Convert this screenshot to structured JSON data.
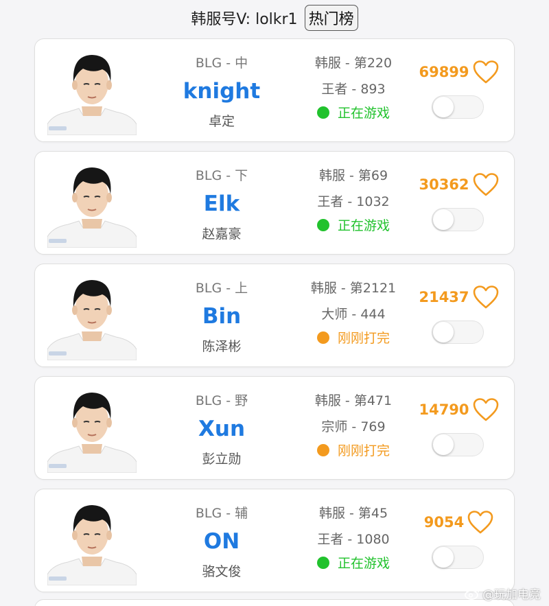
{
  "header": {
    "title": "韩服号V: lolkr1",
    "hot_button": "热门榜"
  },
  "colors": {
    "nickname": "#1f7ae0",
    "score": "#f39a1e",
    "playing": "#21c22d",
    "recent": "#f39a1e"
  },
  "players": [
    {
      "team_pos": "BLG - 中",
      "nickname": "knight",
      "real_name": "卓定",
      "server_rank": "韩服 - 第220",
      "tier": "王者 - 893",
      "status": "正在游戏",
      "status_color": "#21c22d",
      "score": "69899",
      "favorite_icon": "heart-outline-icon",
      "notify_on": false,
      "avatar_icon": "player-photo"
    },
    {
      "team_pos": "BLG - 下",
      "nickname": "Elk",
      "real_name": "赵嘉豪",
      "server_rank": "韩服 - 第69",
      "tier": "王者 - 1032",
      "status": "正在游戏",
      "status_color": "#21c22d",
      "score": "30362",
      "favorite_icon": "heart-outline-icon",
      "notify_on": false,
      "avatar_icon": "player-photo"
    },
    {
      "team_pos": "BLG - 上",
      "nickname": "Bin",
      "real_name": "陈泽彬",
      "server_rank": "韩服 - 第2121",
      "tier": "大师 - 444",
      "status": "刚刚打完",
      "status_color": "#f39a1e",
      "score": "21437",
      "favorite_icon": "heart-outline-icon",
      "notify_on": false,
      "avatar_icon": "player-photo"
    },
    {
      "team_pos": "BLG - 野",
      "nickname": "Xun",
      "real_name": "彭立勋",
      "server_rank": "韩服 - 第471",
      "tier": "宗师 - 769",
      "status": "刚刚打完",
      "status_color": "#f39a1e",
      "score": "14790",
      "favorite_icon": "heart-outline-icon",
      "notify_on": false,
      "avatar_icon": "player-photo"
    },
    {
      "team_pos": "BLG - 辅",
      "nickname": "ON",
      "real_name": "骆文俊",
      "server_rank": "韩服 - 第45",
      "tier": "王者 - 1080",
      "status": "正在游戏",
      "status_color": "#21c22d",
      "score": "9054",
      "favorite_icon": "heart-outline-icon",
      "notify_on": false,
      "avatar_icon": "player-photo"
    }
  ],
  "watermark": {
    "icon": "weibo-icon",
    "text": "@玩加电竞"
  }
}
